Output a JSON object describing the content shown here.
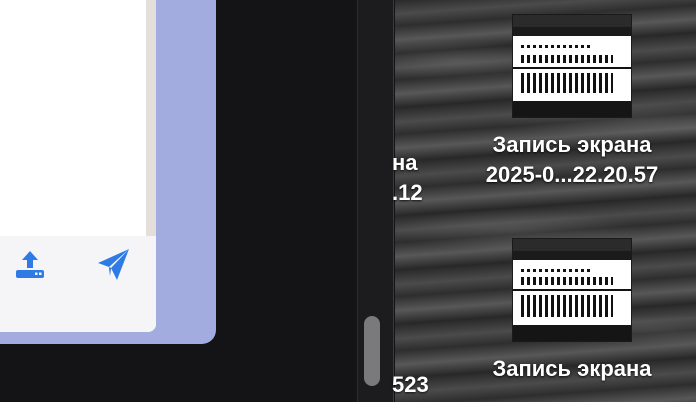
{
  "app": {
    "icons": [
      "upload-icon",
      "send-icon"
    ],
    "accent": "#2f7be6"
  },
  "desktop": {
    "files": [
      {
        "name_line1": "Запись экрана",
        "name_line2": "2025-0...22.20.57",
        "icon": "screen-recording-thumbnail"
      },
      {
        "name_line1": "Запись экрана",
        "icon": "screen-recording-thumbnail"
      }
    ],
    "partial_labels": [
      "на",
      ".12",
      "523"
    ]
  }
}
